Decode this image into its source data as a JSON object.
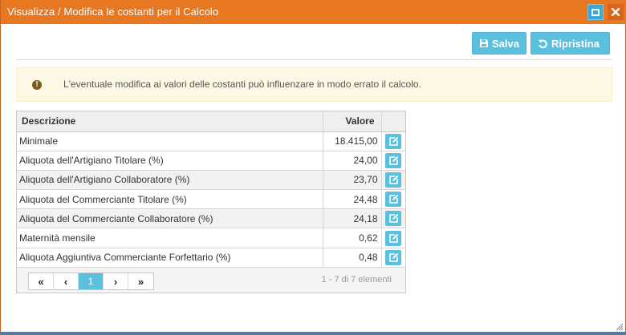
{
  "window": {
    "title": "Visualizza / Modifica le costanti per il Calcolo",
    "accent_color": "#e87722",
    "icons": {
      "maximize": "maximize-icon",
      "close": "close-icon",
      "resize": "resize-grip-icon"
    }
  },
  "toolbar": {
    "save_label": "Salva",
    "reset_label": "Ripristina",
    "button_color": "#5bc0de",
    "icons": {
      "save": "floppy-disk-icon",
      "reset": "undo-icon"
    }
  },
  "alert": {
    "icon": "exclamation-icon",
    "message": "L'eventuale modifica ai valori delle costanti può influenzare in modo errato il calcolo."
  },
  "table": {
    "columns": [
      "Descrizione",
      "Valore",
      ""
    ],
    "rows": [
      {
        "descrizione": "Minimale",
        "valore": "18.415,00"
      },
      {
        "descrizione": "Aliquota dell'Artigiano Titolare (%)",
        "valore": "24,00"
      },
      {
        "descrizione": "Aliquota dell'Artigiano Collaboratore (%)",
        "valore": "23,70"
      },
      {
        "descrizione": "Aliquota del Commerciante Titolare (%)",
        "valore": "24,48"
      },
      {
        "descrizione": "Aliquota del Commerciante Collaboratore (%)",
        "valore": "24,18"
      },
      {
        "descrizione": "Maternità mensile",
        "valore": "0,62"
      },
      {
        "descrizione": "Aliquota Aggiuntiva Commerciante Forfettario (%)",
        "valore": "0,48"
      }
    ],
    "row_action_icon": "edit-icon"
  },
  "pager": {
    "first": "«",
    "prev": "‹",
    "current_page": "1",
    "next": "›",
    "last": "»",
    "info": "1 - 7 di 7 elementi"
  }
}
